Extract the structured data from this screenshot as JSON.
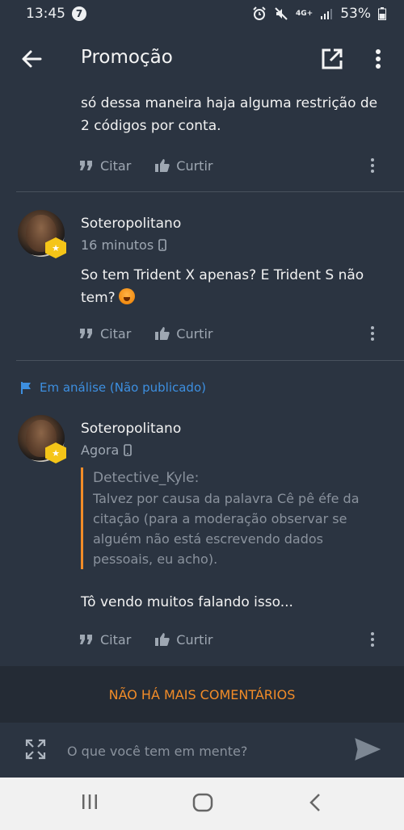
{
  "status_bar": {
    "time": "13:45",
    "notification_count": "7",
    "network": "4G+",
    "battery": "53%"
  },
  "app_bar": {
    "title": "Promoção"
  },
  "comments": [
    {
      "partial_text": "só dessa maneira haja alguma restrição de 2 códigos por conta.",
      "actions": {
        "quote_label": "Citar",
        "like_label": "Curtir"
      }
    },
    {
      "author": "Soteropolitano",
      "time": "16 minutos",
      "text": "So tem Trident X apenas? E Trident S não tem?",
      "actions": {
        "quote_label": "Citar",
        "like_label": "Curtir"
      }
    },
    {
      "review_status": "Em análise (Não publicado)",
      "author": "Soteropolitano",
      "time": "Agora",
      "quote": {
        "author": "Detective_Kyle:",
        "text": "Talvez por causa da palavra Cê pê éfe da citação (para a moderação observar se alguém não está escrevendo dados pessoais, eu acho)."
      },
      "text": "Tô vendo muitos falando isso...",
      "actions": {
        "quote_label": "Citar",
        "like_label": "Curtir"
      }
    }
  ],
  "footer": {
    "no_more_comments": "NÃO HÁ MAIS COMENTÁRIOS"
  },
  "composer": {
    "placeholder": "O que você tem em mente?"
  },
  "colors": {
    "background": "#2b3441",
    "accent": "#f28c28",
    "link": "#3d8fe0",
    "muted": "#9ea7b2"
  }
}
